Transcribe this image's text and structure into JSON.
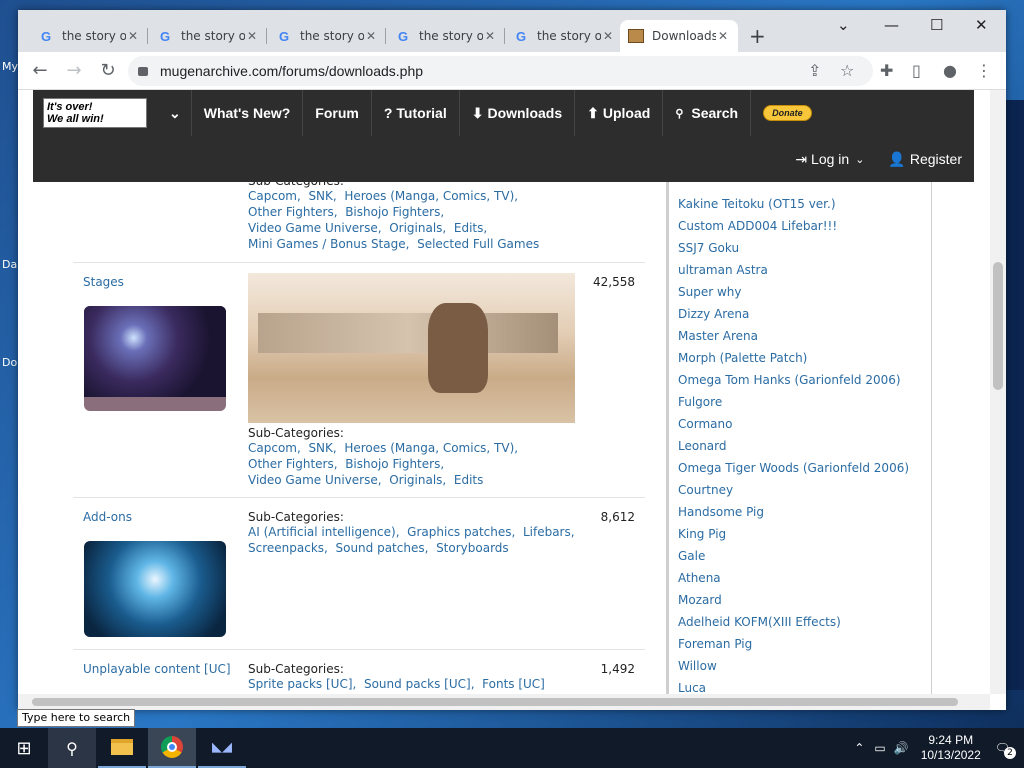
{
  "desktop": {
    "labels": [
      "My",
      "Da",
      "Do"
    ]
  },
  "browser": {
    "tabs": [
      {
        "title": "the story of",
        "icon": "google-icon"
      },
      {
        "title": "the story of",
        "icon": "google-icon"
      },
      {
        "title": "the story of",
        "icon": "google-icon"
      },
      {
        "title": "the story of",
        "icon": "google-icon"
      },
      {
        "title": "the story of",
        "icon": "google-icon"
      },
      {
        "title": "Downloads",
        "icon": "package-icon",
        "active": true
      }
    ],
    "url": "mugenarchive.com/forums/downloads.php"
  },
  "site": {
    "logo_line1": "It's over!",
    "logo_line2": "We all win!",
    "nav": [
      "What's New?",
      "Forum",
      "Tutorial",
      "Downloads",
      "Upload",
      "Search"
    ],
    "donate": "Donate",
    "login": "Log in",
    "register": "Register"
  },
  "categories": [
    {
      "title": "",
      "subcategories_label": "Sub-Categories:",
      "links": [
        [
          "Capcom",
          "SNK",
          "Heroes (Manga, Comics, TV)"
        ],
        [
          "Other Fighters",
          "Bishojo Fighters"
        ],
        [
          "Video Game Universe",
          "Originals",
          "Edits"
        ],
        [
          "Mini Games / Bonus Stage",
          "Selected Full Games"
        ]
      ]
    },
    {
      "title": "Stages",
      "count": "42,558",
      "subcategories_label": "Sub-Categories:",
      "links": [
        [
          "Capcom",
          "SNK",
          "Heroes (Manga, Comics, TV)"
        ],
        [
          "Other Fighters",
          "Bishojo Fighters"
        ],
        [
          "Video Game Universe",
          "Originals",
          "Edits"
        ]
      ]
    },
    {
      "title": "Add-ons",
      "count": "8,612",
      "subcategories_label": "Sub-Categories:",
      "links": [
        [
          "AI (Artificial intelligence)",
          "Graphics patches",
          "Lifebars"
        ],
        [
          "Screenpacks",
          "Sound patches",
          "Storyboards"
        ]
      ]
    },
    {
      "title": "Unplayable content [UC]",
      "count": "1,492",
      "subcategories_label": "Sub-Categories:",
      "links": [
        [
          "Sprite packs [UC]",
          "Sound packs [UC]",
          "Fonts [UC]"
        ]
      ]
    }
  ],
  "sidebar": {
    "items": [
      "Kakine Teitoku (OT15 ver.)",
      "Custom ADD004 Lifebar!!!",
      "SSJ7 Goku",
      "ultraman Astra",
      "Super why",
      "Dizzy Arena",
      "Master Arena",
      "Morph (Palette Patch)",
      "Omega Tom Hanks (Garionfeld 2006)",
      "Fulgore",
      "Cormano",
      "Leonard",
      "Omega Tiger Woods (Garionfeld 2006)",
      "Courtney",
      "Handsome Pig",
      "King Pig",
      "Gale",
      "Athena",
      "Mozard",
      "Adelheid KOFM(XIII Effects)",
      "Foreman Pig",
      "Willow",
      "Luca"
    ]
  },
  "taskbar": {
    "search_tooltip": "Type here to search",
    "time": "9:24 PM",
    "date": "10/13/2022",
    "notifications": "2"
  }
}
